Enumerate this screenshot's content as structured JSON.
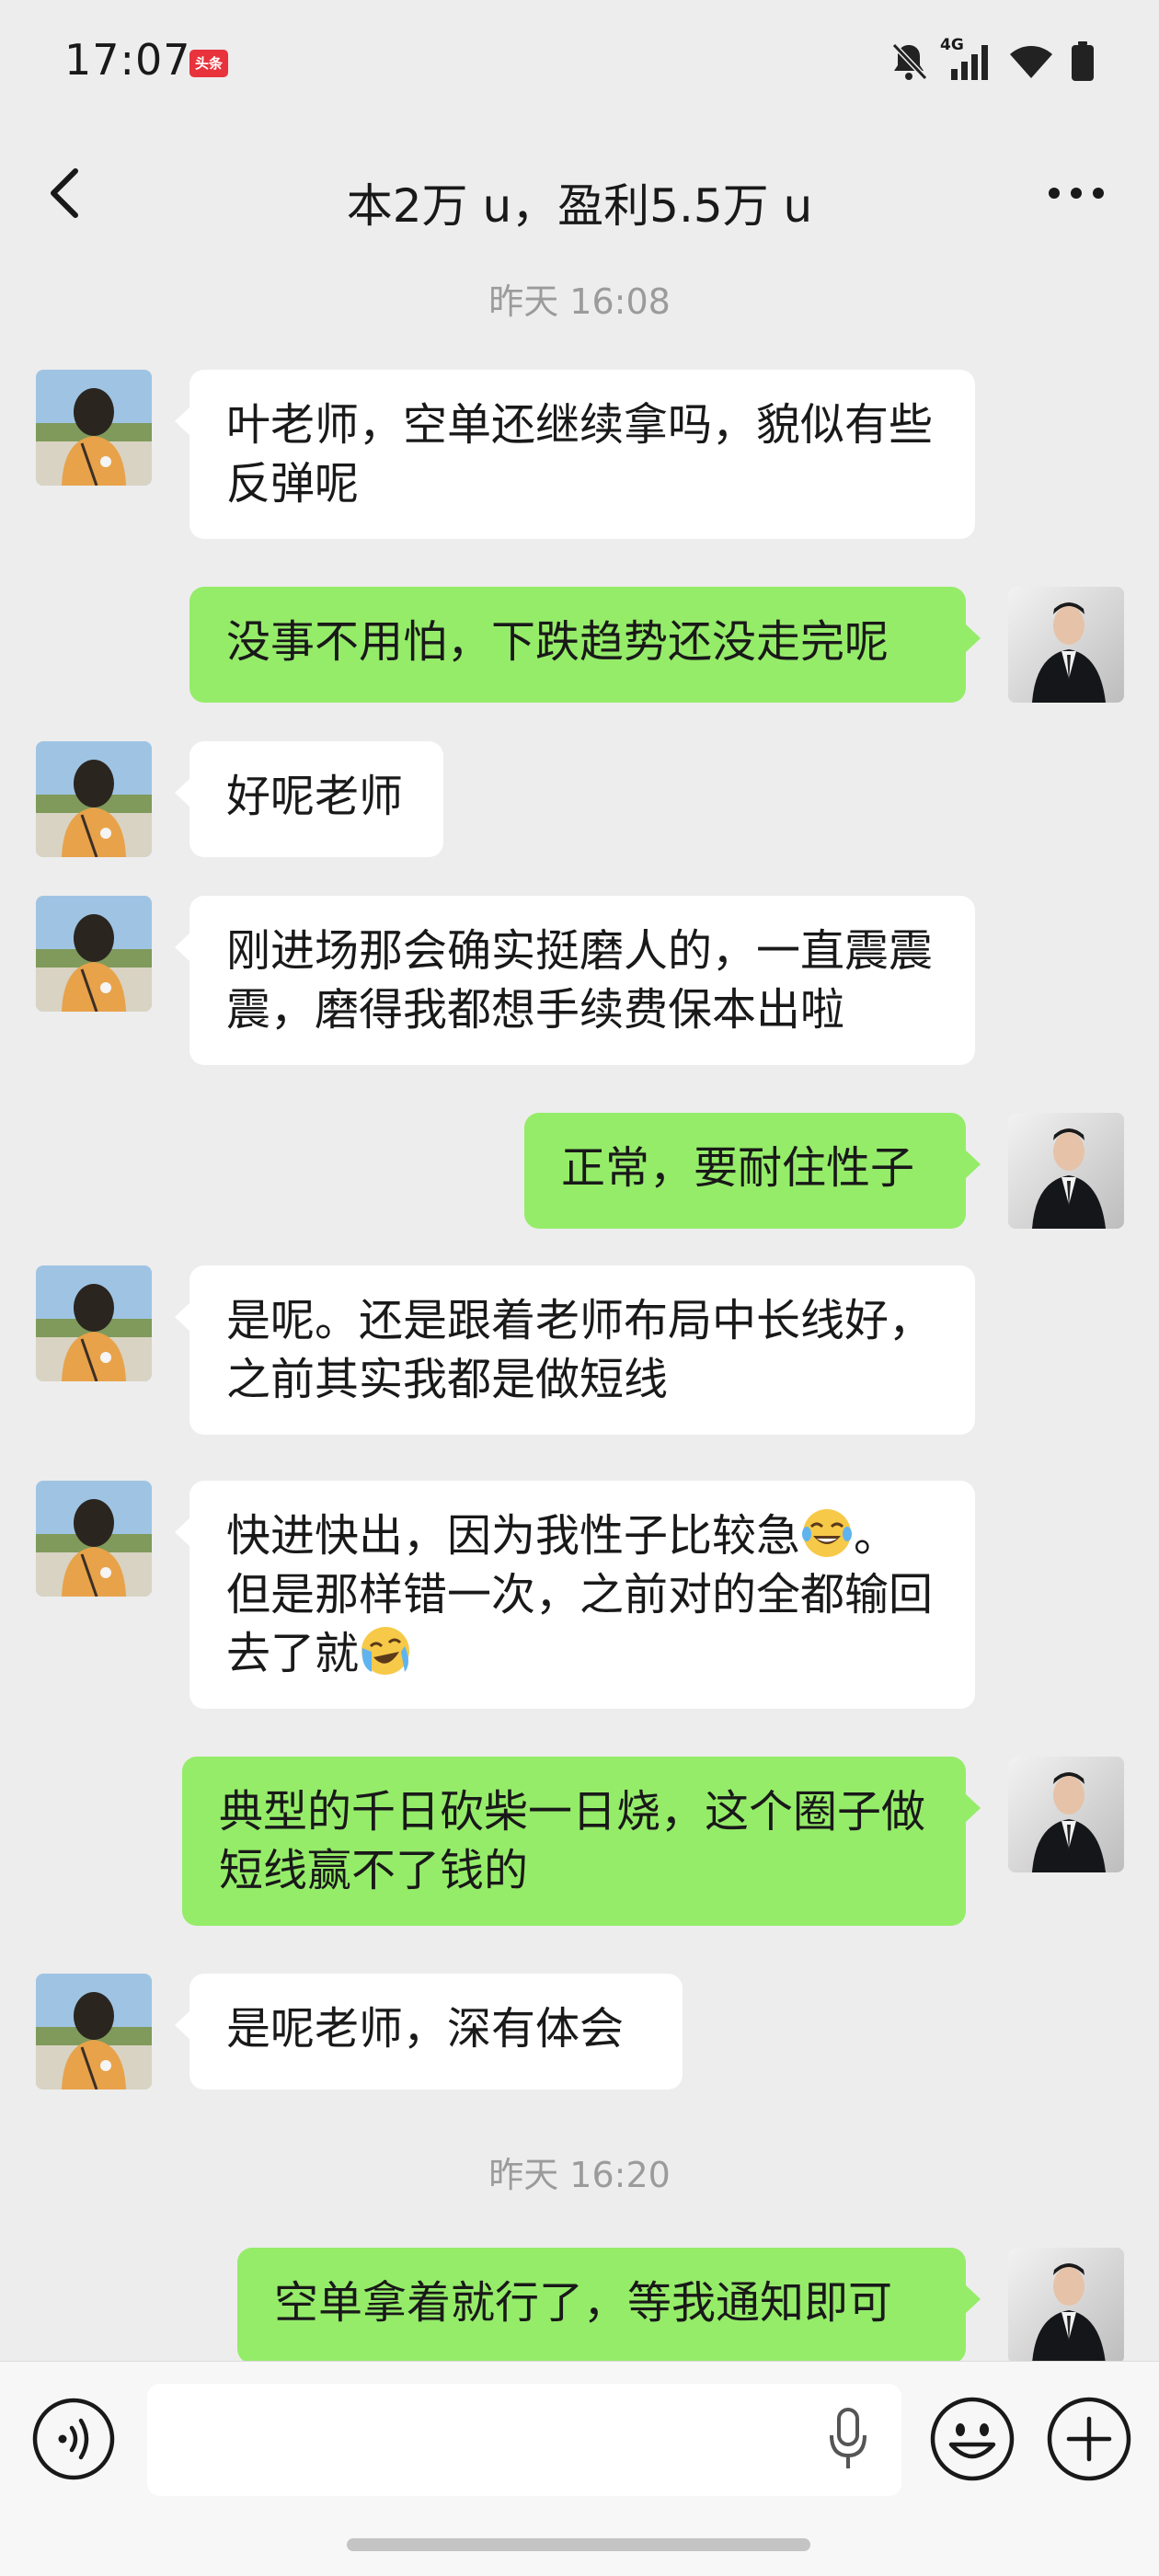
{
  "status_bar": {
    "time": "17:07",
    "news_badge": "头条",
    "network_type": "4G",
    "icons": [
      "news-app-icon",
      "mute-bell-icon",
      "signal-icon",
      "wifi-icon",
      "battery-icon"
    ]
  },
  "header": {
    "title": "本2万 u，盈利5.5万 u",
    "back_icon": "chevron-left-icon",
    "more_icon": "more-dots-icon"
  },
  "colors": {
    "background": "#ededed",
    "incoming_bubble": "#ffffff",
    "outgoing_bubble": "#95ec69",
    "timestamp": "#9b9b9b"
  },
  "messages": {
    "ts1": "昨天 16:08",
    "m1": "叶老师，空单还继续拿吗，貌似有些反弹呢",
    "m2": "没事不用怕，下跌趋势还没走完呢",
    "m3": "好呢老师",
    "m4": "刚进场那会确实挺磨人的，一直震震震，磨得我都想手续费保本出啦",
    "m5": "正常，要耐住性子",
    "m6": "是呢。还是跟着老师布局中长线好，之前其实我都是做短线",
    "m7a": "快进快出，因为我性子比较急",
    "m7b": "。但是那样错一次，之前对的全都输回去了就",
    "m8": "典型的千日砍柴一日烧，这个圈子做短线赢不了钱的",
    "m9": "是呢老师，深有体会",
    "ts2": "昨天 16:20",
    "m10": "空单拿着就行了，等我通知即可"
  },
  "input_bar": {
    "text_value": "",
    "icons": [
      "voice-icon",
      "microphone-icon",
      "emoji-icon",
      "plus-icon"
    ]
  }
}
